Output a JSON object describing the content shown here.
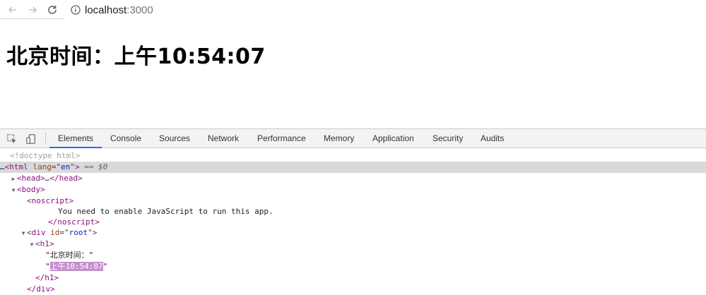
{
  "browser": {
    "url_host": "localhost",
    "url_port": ":3000"
  },
  "page": {
    "heading": "北京时间：上午10:54:07"
  },
  "devtools": {
    "tabs": [
      "Elements",
      "Console",
      "Sources",
      "Network",
      "Performance",
      "Memory",
      "Application",
      "Security",
      "Audits"
    ],
    "active_tab": "Elements",
    "accent_color": "#1a73e8",
    "tree": {
      "doctype": "<!doctype html>",
      "html_open_tag": "<html",
      "html_attr_name": "lang",
      "html_attr_value": "en",
      "html_close_bracket": ">",
      "selected_marker": "== $0",
      "head": "<head>…</head>",
      "body_open": "<body>",
      "noscript_open": "<noscript>",
      "noscript_text": "You need to enable JavaScript to run this app.",
      "noscript_close": "</noscript>",
      "div_open_tag": "<div",
      "div_attr_name": "id",
      "div_attr_value": "root",
      "div_close_bracket": ">",
      "h1_open": "<h1>",
      "text_node_1": "北京时间：",
      "text_node_2": "上午10:54:07",
      "h1_close": "</h1>",
      "div_close": "</div>"
    }
  }
}
